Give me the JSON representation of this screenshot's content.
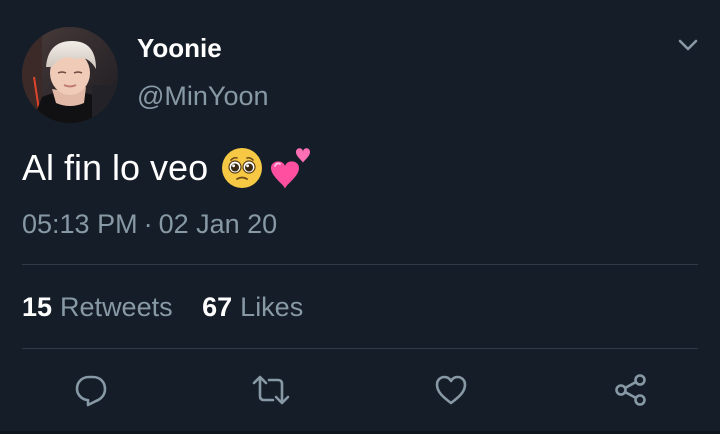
{
  "tweet": {
    "author": {
      "display_name": "Yoonie",
      "handle": "@MinYoon"
    },
    "text": "Al fin lo veo",
    "emojis": [
      "pleading-face",
      "two-hearts"
    ],
    "timestamp": {
      "time": "05:13 PM",
      "separator": "·",
      "date": "02 Jan 20"
    },
    "stats": {
      "retweets_count": "15",
      "retweets_label": "Retweets",
      "likes_count": "67",
      "likes_label": "Likes"
    },
    "actions": [
      "reply",
      "retweet",
      "like",
      "share"
    ]
  },
  "colors": {
    "background": "#151d28",
    "primary_text": "#ffffff",
    "secondary_text": "#8899a6",
    "divider": "#2f3b47"
  }
}
